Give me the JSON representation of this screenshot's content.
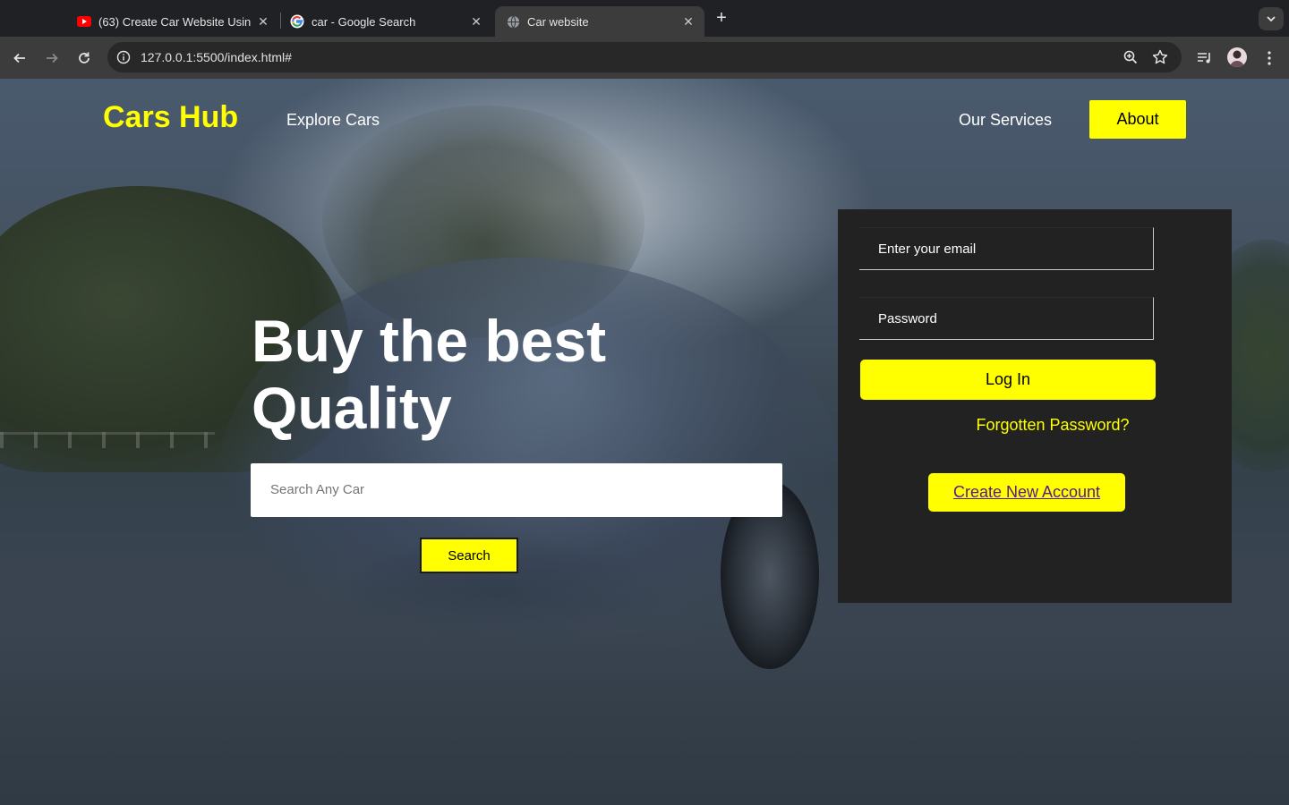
{
  "browser": {
    "tabs": [
      {
        "title": "(63) Create Car Website Usin",
        "icon": "youtube-icon",
        "active": false
      },
      {
        "title": "car - Google Search",
        "icon": "google-icon",
        "active": false
      },
      {
        "title": "Car website",
        "icon": "globe-icon",
        "active": true
      }
    ],
    "url": "127.0.0.1:5500/index.html#"
  },
  "site": {
    "logo": "Cars Hub",
    "nav": {
      "explore": "Explore Cars",
      "services": "Our Services",
      "about": "About"
    },
    "hero": {
      "line1": "Buy the best",
      "line2": "Quality"
    },
    "search": {
      "placeholder": "Search Any Car",
      "button": "Search"
    },
    "login": {
      "email_placeholder": "Enter your email",
      "password_placeholder": "Password",
      "login_button": "Log In",
      "forgot": "Forgotten Password?",
      "create_account": "Create New Account"
    }
  },
  "colors": {
    "accent": "#ffff00",
    "panel": "#222222",
    "link_visited": "#551a8b"
  }
}
